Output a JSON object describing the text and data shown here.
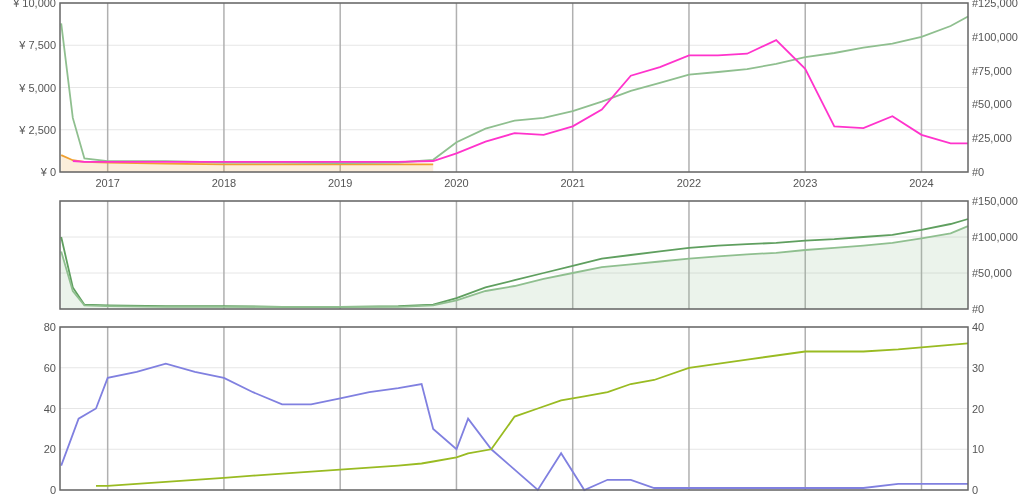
{
  "charts": [
    {
      "chart_data": {
        "type": "line",
        "grid": true,
        "xlim": [
          2016.59,
          2024.4
        ],
        "xticks": [
          2017,
          2018,
          2019,
          2020,
          2021,
          2022,
          2023,
          2024
        ],
        "ylim": [
          0,
          10000
        ],
        "yticks": [
          {
            "value": 0,
            "label": "¥ 0"
          },
          {
            "value": 2500,
            "label": "¥ 2,500"
          },
          {
            "value": 5000,
            "label": "¥ 5,000"
          },
          {
            "value": 7500,
            "label": "¥ 7,500"
          },
          {
            "value": 10000,
            "label": "¥ 10,000"
          }
        ],
        "y2lim": [
          0,
          125000
        ],
        "y2ticks": [
          {
            "value": 0,
            "label": "#0"
          },
          {
            "value": 25000,
            "label": "#25,000"
          },
          {
            "value": 50000,
            "label": "#50,000"
          },
          {
            "value": 75000,
            "label": "#75,000"
          },
          {
            "value": 100000,
            "label": "#100,000"
          },
          {
            "value": 125000,
            "label": "#125,000"
          }
        ],
        "x": [
          2016.6,
          2016.7,
          2016.8,
          2017,
          2017.5,
          2018,
          2018.5,
          2019,
          2019.5,
          2019.8,
          2020,
          2020.25,
          2020.5,
          2020.75,
          2021,
          2021.25,
          2021.5,
          2021.75,
          2022,
          2022.25,
          2022.5,
          2022.75,
          2023,
          2023.25,
          2023.5,
          2023.75,
          2024,
          2024.25,
          2024.4
        ],
        "series": [
          {
            "color": "#f0a030",
            "type": "area",
            "values": [
              1000,
              700,
              600,
              550,
              500,
              450,
              450,
              450,
              450,
              450,
              null,
              null,
              null,
              null,
              null,
              null,
              null,
              null,
              null,
              null,
              null,
              null,
              null,
              null,
              null,
              null,
              null,
              null,
              null
            ]
          },
          {
            "color": "#8fbf8f",
            "axis": "y2",
            "values": [
              110000,
              40000,
              10000,
              8000,
              8000,
              7000,
              7000,
              6500,
              7000,
              9000,
              22000,
              32000,
              38000,
              40000,
              45000,
              52000,
              60000,
              66000,
              72000,
              74000,
              76000,
              80000,
              85000,
              88000,
              92000,
              95000,
              100000,
              108000,
              115000
            ]
          },
          {
            "color": "#ff33cc",
            "values": [
              null,
              650,
              600,
              600,
              600,
              600,
              600,
              600,
              600,
              650,
              1100,
              1800,
              2300,
              2200,
              2700,
              3700,
              5700,
              6200,
              6900,
              6900,
              7000,
              7800,
              6100,
              2700,
              2600,
              3300,
              2200,
              1700,
              1700
            ]
          }
        ]
      }
    },
    {
      "chart_data": {
        "type": "area",
        "grid": true,
        "xlim": [
          2016.59,
          2024.4
        ],
        "y2lim": [
          0,
          150000
        ],
        "y2ticks": [
          {
            "value": 0,
            "label": "#0"
          },
          {
            "value": 50000,
            "label": "#50,000"
          },
          {
            "value": 100000,
            "label": "#100,000"
          },
          {
            "value": 150000,
            "label": "#150,000"
          }
        ],
        "x": [
          2016.6,
          2016.7,
          2016.8,
          2017,
          2017.5,
          2018,
          2018.5,
          2019,
          2019.5,
          2019.8,
          2020,
          2020.25,
          2020.5,
          2020.75,
          2021,
          2021.25,
          2021.5,
          2021.75,
          2022,
          2022.25,
          2022.5,
          2022.75,
          2023,
          2023.25,
          2023.5,
          2023.75,
          2024,
          2024.25,
          2024.4
        ],
        "series": [
          {
            "color": "#5f9f5f",
            "axis": "y2",
            "type": "line",
            "values": [
              100000,
              30000,
              6000,
              5000,
              4000,
              4000,
              3000,
              3000,
              4000,
              6000,
              15000,
              30000,
              40000,
              50000,
              60000,
              70000,
              75000,
              80000,
              85000,
              88000,
              90000,
              92000,
              95000,
              97000,
              100000,
              103000,
              110000,
              118000,
              125000
            ]
          },
          {
            "color": "#8fbf8f",
            "axis": "y2",
            "values": [
              80000,
              25000,
              5000,
              4000,
              3000,
              3000,
              3000,
              3000,
              3000,
              5000,
              12000,
              25000,
              32000,
              42000,
              50000,
              58000,
              62000,
              66000,
              70000,
              73000,
              76000,
              78000,
              82000,
              85000,
              88000,
              92000,
              98000,
              105000,
              115000
            ]
          }
        ]
      }
    },
    {
      "chart_data": {
        "type": "line",
        "grid": true,
        "xlim": [
          2016.59,
          2024.4
        ],
        "ylim": [
          0,
          80
        ],
        "yticks": [
          {
            "value": 0,
            "label": "0"
          },
          {
            "value": 20,
            "label": "20"
          },
          {
            "value": 40,
            "label": "40"
          },
          {
            "value": 60,
            "label": "60"
          },
          {
            "value": 80,
            "label": "80"
          }
        ],
        "y2lim": [
          0,
          40
        ],
        "y2ticks": [
          {
            "value": 0,
            "label": "0"
          },
          {
            "value": 10,
            "label": "10"
          },
          {
            "value": 20,
            "label": "20"
          },
          {
            "value": 30,
            "label": "30"
          },
          {
            "value": 40,
            "label": "40"
          }
        ],
        "x": [
          2016.6,
          2016.75,
          2016.9,
          2017,
          2017.25,
          2017.5,
          2017.75,
          2018,
          2018.25,
          2018.5,
          2018.75,
          2019,
          2019.25,
          2019.5,
          2019.7,
          2019.8,
          2020,
          2020.1,
          2020.3,
          2020.5,
          2020.7,
          2020.9,
          2021.1,
          2021.3,
          2021.5,
          2021.7,
          2022,
          2022.5,
          2023,
          2023.5,
          2023.8,
          2024,
          2024.4
        ],
        "series": [
          {
            "color": "#8080e0",
            "values": [
              12,
              35,
              40,
              55,
              58,
              62,
              58,
              55,
              48,
              42,
              42,
              45,
              48,
              50,
              52,
              30,
              20,
              35,
              20,
              10,
              0,
              18,
              0,
              5,
              5,
              1,
              1,
              1,
              1,
              1,
              3,
              3,
              3
            ]
          },
          {
            "color": "#99bb22",
            "axis": "y2",
            "values": [
              null,
              null,
              1,
              1,
              1.5,
              2,
              2.5,
              3,
              3.5,
              4,
              4.5,
              5,
              5.5,
              6,
              6.5,
              7,
              8,
              9,
              10,
              18,
              20,
              22,
              23,
              24,
              26,
              27,
              30,
              32,
              34,
              34,
              34.5,
              35,
              36
            ]
          }
        ]
      }
    }
  ]
}
